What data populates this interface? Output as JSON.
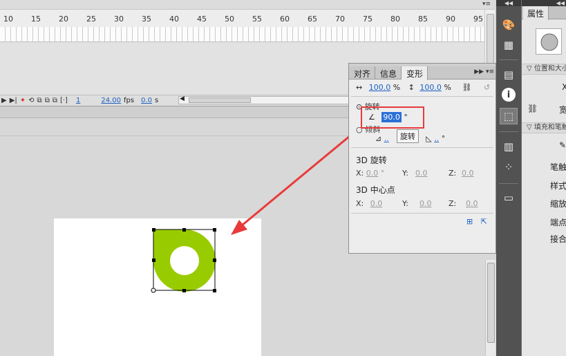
{
  "timeline": {
    "ruler_numbers": [
      "10",
      "15",
      "20",
      "25",
      "30",
      "35",
      "40",
      "45",
      "50",
      "55",
      "60",
      "65",
      "70",
      "75",
      "80",
      "85",
      "90",
      "95"
    ],
    "menu_glyph": "▾≡",
    "frame": "1",
    "fps_value": "24.00",
    "fps_unit": "fps",
    "time_value": "0.0",
    "time_unit": "s",
    "ctrl_glyphs": [
      "▶",
      "▶|",
      "✦",
      "⟲",
      "⧉",
      "⧉",
      "⧉",
      "[·]"
    ]
  },
  "transform_panel": {
    "tabs": [
      "对齐",
      "信息",
      "变形"
    ],
    "active_tab": "变形",
    "tab_menu": "▶▶ ▾≡",
    "scale_width": "100.0",
    "scale_height": "100.0",
    "percent": "%",
    "rotate_label": "旋转",
    "rotate_value": "90.0",
    "degree": "°",
    "skew_label": "倾斜",
    "tooltip": "旋转",
    "rot3d_label": "3D 旋转",
    "center3d_label": "3D 中心点",
    "x_label": "X:",
    "y_label": "Y:",
    "z_label": "Z:",
    "rot3d_x": "0.0",
    "rot3d_y": "0.0",
    "rot3d_z": "0.0",
    "c3d_x": "0.0",
    "c3d_y": "0.0",
    "c3d_z": "0.0",
    "ellipsis": "..",
    "footer_icons": [
      "⊞",
      "⇱"
    ]
  },
  "dock": {
    "collapse": "◀◀",
    "buttons": [
      "palette-icon",
      "swatches-icon",
      "align-icon",
      "info-icon",
      "transform-icon",
      "library-icon",
      "motion-presets-icon",
      "components-icon"
    ]
  },
  "properties": {
    "collapse": "◀◀",
    "tab": "属性",
    "section_position": "位置和大小",
    "section_fill": "填充和笔触",
    "labels": [
      "X",
      "宽",
      "笔触",
      "样式",
      "缩放",
      "端点",
      "接合"
    ]
  },
  "colors": {
    "donut": "#99cc00",
    "arrow": "#e83a3a",
    "accent": "#1a5fc4"
  }
}
